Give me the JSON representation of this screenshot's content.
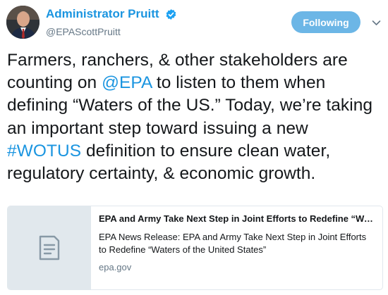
{
  "author": {
    "display_name": "Administrator Pruitt",
    "handle": "@EPAScottPruitt",
    "verified": true,
    "avatar_icon": "profile-photo"
  },
  "actions": {
    "follow_label": "Following",
    "menu_icon": "chevron-down-icon"
  },
  "colors": {
    "link": "#1b95e0",
    "follow_button": "#6cb6e6",
    "text": "#14171a",
    "muted": "#657786",
    "card_thumb": "#e1e8ed"
  },
  "tweet": {
    "segments": [
      {
        "text": "Farmers, ranchers, & other stakeholders are counting on ",
        "link": false
      },
      {
        "text": "@EPA",
        "link": true
      },
      {
        "text": " to listen to them when defining “Waters of the US.” Today, we’re taking an important step toward issuing a new ",
        "link": false
      },
      {
        "text": "#WOTUS",
        "link": true
      },
      {
        "text": " definition to ensure clean water, regulatory certainty, & economic growth.",
        "link": false
      }
    ]
  },
  "card": {
    "thumb_icon": "document-icon",
    "title": "EPA and Army Take Next Step in Joint Efforts to Redefine “Waters of the United States”",
    "description": "EPA News Release: EPA and Army Take Next Step in Joint Efforts to Redefine “Waters of the United States”",
    "domain": "epa.gov"
  }
}
